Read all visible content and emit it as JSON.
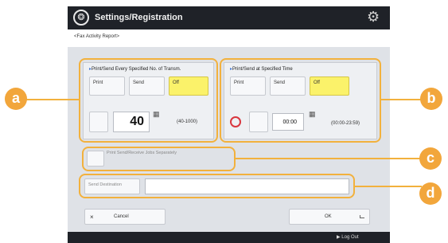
{
  "window": {
    "title": "Settings/Registration"
  },
  "breadcrumb": "<Fax Activity Report>",
  "every_transm": {
    "label": "Print/Send Every Specified No. of Transm.",
    "buttons": [
      "Print",
      "Send",
      "Off"
    ],
    "selected": "Off",
    "value": "40",
    "range": "(40-1000)"
  },
  "specified_time": {
    "label": "Print/Send at Specified Time",
    "buttons": [
      "Print",
      "Send",
      "Off"
    ],
    "selected": "Off",
    "time": "00:00",
    "range": "(00:00-23:59)"
  },
  "separately": {
    "label": "Print Send/Receive Jobs Separately"
  },
  "destination": {
    "button_label": "Send Destination",
    "value": ""
  },
  "actions": {
    "cancel": "Cancel",
    "ok": "OK"
  },
  "footer": {
    "logout": "Log Out"
  },
  "callouts": [
    "a",
    "b",
    "c",
    "d"
  ],
  "colors": {
    "accent": "#f2a63b",
    "selected": "#fbf26a",
    "header": "#1f2228",
    "clock": "#d9363e"
  }
}
